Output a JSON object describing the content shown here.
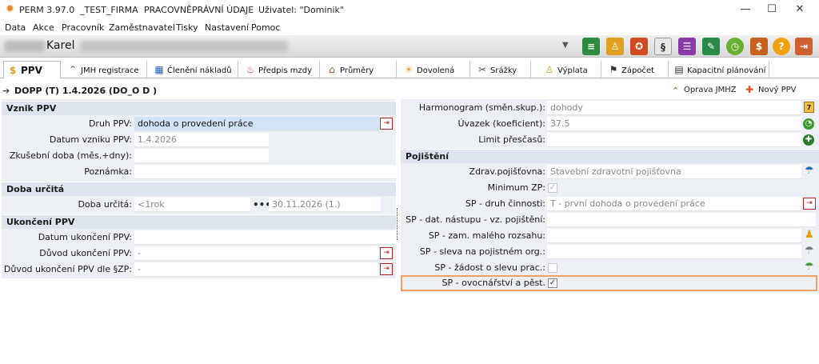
{
  "titlebar": {
    "app": "PERM 3.97.0",
    "firm": "_TEST_FIRMA",
    "module": "PRACOVNĚPRÁVNÍ ÚDAJE",
    "user": "Uživatel: \"Dominik\""
  },
  "menu": [
    "Data",
    "Akce",
    "Pracovník",
    "Zaměstnavatel",
    "Tisky",
    "Nastavení",
    "Pomoc"
  ],
  "employee": {
    "first_name": "Karel"
  },
  "tabs": [
    {
      "label": "PPV",
      "icon": "ppv-icon",
      "active": true
    },
    {
      "label": "JMH registrace",
      "icon": "jmh-icon"
    },
    {
      "label": "Členění nákladů",
      "icon": "costs-icon"
    },
    {
      "label": "Předpis mzdy",
      "icon": "wage-icon"
    },
    {
      "label": "Průměry",
      "icon": "average-icon"
    },
    {
      "label": "Dovolená",
      "icon": "vacation-icon"
    },
    {
      "label": "Srážky",
      "icon": "deduction-icon"
    },
    {
      "label": "Výplata",
      "icon": "payout-icon"
    },
    {
      "label": "Zápočet",
      "icon": "credit-icon"
    },
    {
      "label": "Kapacitní plánování",
      "icon": "capacity-icon"
    }
  ],
  "header": {
    "title": "DOPP (T) 1.4.2026 (DO_O D )",
    "oprava": "Oprava JMHZ",
    "nova": "Nový PPV"
  },
  "left": {
    "vznik": {
      "title": "Vznik PPV",
      "druh_label": "Druh PPV:",
      "druh_value": "dohoda o provedení práce",
      "datum_label": "Datum vzniku PPV:",
      "datum_value": "1.4.2026",
      "zkusebni_label": "Zkušební doba (měs.+dny):",
      "poznamka_label": "Poznámka:"
    },
    "doba": {
      "title": "Doba určitá",
      "label": "Doba určitá:",
      "value": "<1rok",
      "end": "30.11.2026 (1.)"
    },
    "ukonceni": {
      "title": "Ukončení PPV",
      "datum_label": "Datum ukončení PPV:",
      "duvod_label": "Důvod ukončení PPV:",
      "duvod_value": "-",
      "duvod_zp_label": "Důvod ukončení PPV dle §ZP:",
      "duvod_zp_value": "-"
    }
  },
  "right": {
    "harmonogram_label": "Harmonogram (směn.skup.):",
    "harmonogram_value": "dohody",
    "uvazek_label": "Úvazek (koeficient):",
    "uvazek_value": "37.5",
    "limit_label": "Limit přesčasů:",
    "pojisteni_title": "Pojištění",
    "zdrav_label": "Zdrav.pojišťovna:",
    "zdrav_value": "Stavební zdravotní pojišťovna",
    "minzp_label": "Minimum ZP:",
    "sp_druh_label": "SP - druh činnosti:",
    "sp_druh_value": "T - první dohoda o provedení práce",
    "sp_dat_label": "SP - dat. nástupu - vz. pojištění:",
    "sp_zam_label": "SP - zam. malého rozsahu:",
    "sp_sleva_label": "SP - sleva na pojistném org.:",
    "sp_zadost_label": "SP - žádost o slevu prac.:",
    "sp_ovoc_label": "SP - ovocnářství a pěst. zeleniny:"
  }
}
